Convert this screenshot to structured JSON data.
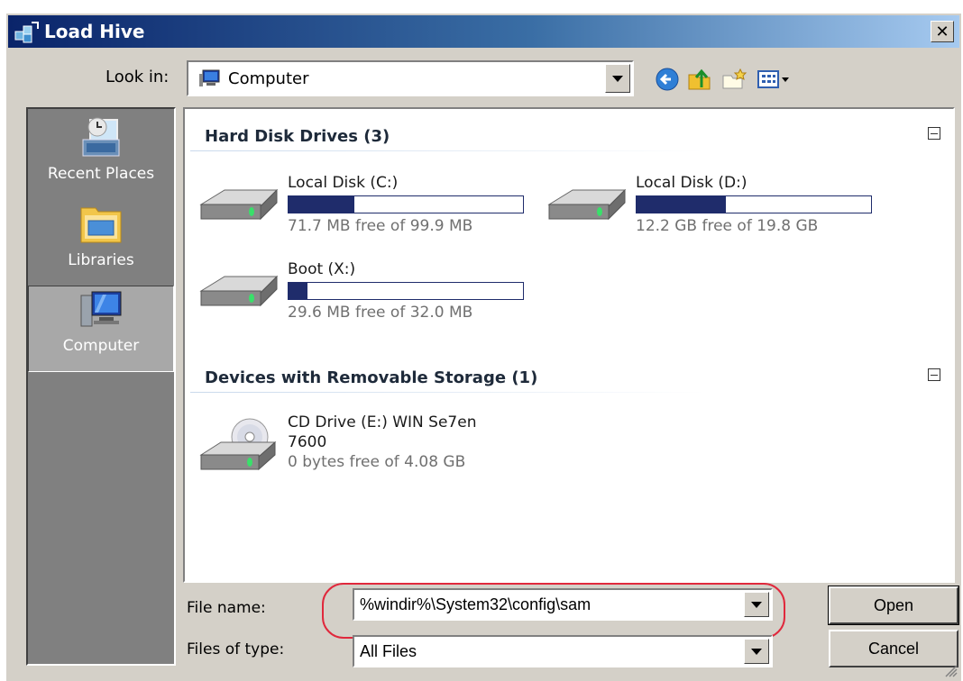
{
  "window": {
    "title": "Load Hive",
    "close_label": "✕"
  },
  "look_in": {
    "label": "Look in:",
    "value": "Computer"
  },
  "places": [
    {
      "label": "Recent Places",
      "icon": "recent-places-icon"
    },
    {
      "label": "Libraries",
      "icon": "libraries-icon"
    },
    {
      "label": "Computer",
      "icon": "computer-icon",
      "active": true
    }
  ],
  "groups": {
    "hard_disks": {
      "header": "Hard Disk Drives (3)"
    },
    "removable": {
      "header": "Devices with Removable Storage (1)"
    }
  },
  "drives": [
    {
      "name": "Local Disk (C:)",
      "free": "71.7 MB free of 99.9 MB",
      "used_fraction": 0.28
    },
    {
      "name": "Local Disk (D:)",
      "free": "12.2 GB free of 19.8 GB",
      "used_fraction": 0.38
    },
    {
      "name": "Boot (X:)",
      "free": "29.6 MB free of 32.0 MB",
      "used_fraction": 0.08
    }
  ],
  "cd_drive": {
    "name_line1": "CD Drive (E:) WIN Se7en",
    "name_line2": "7600",
    "free": "0 bytes free of 4.08 GB"
  },
  "file_name": {
    "label": "File name:",
    "value": "%windir%\\System32\\config\\sam"
  },
  "files_of_type": {
    "label": "Files of type:",
    "value": "All Files"
  },
  "buttons": {
    "open": "Open",
    "cancel": "Cancel"
  },
  "colors": {
    "highlight_ring": "#e0283c",
    "drive_bar": "#1f2c6b",
    "title_start": "#0a246a"
  }
}
